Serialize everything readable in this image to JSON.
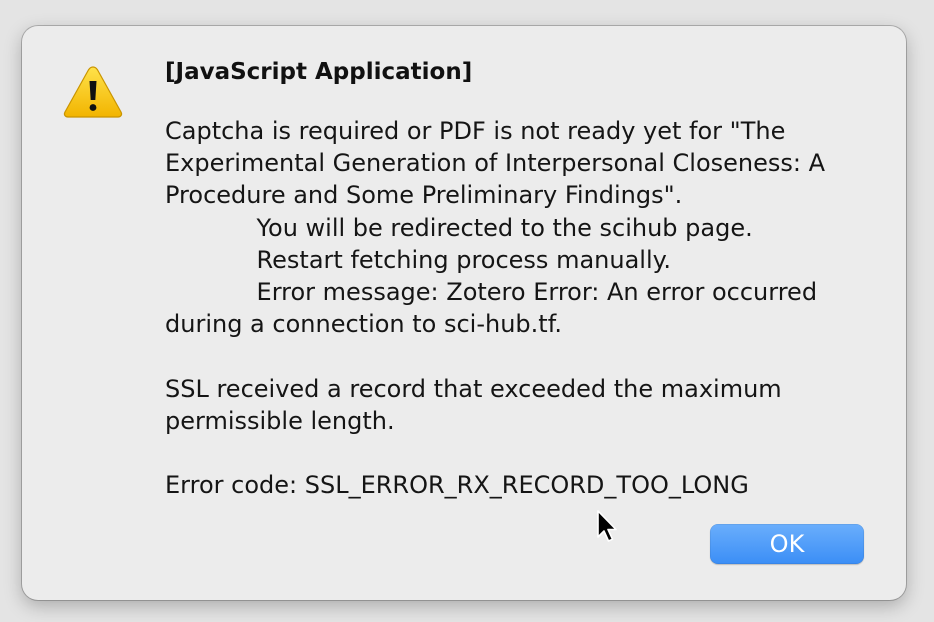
{
  "dialog": {
    "icon": "warning-icon",
    "title": "[JavaScript Application]",
    "message": "Captcha is required or PDF is not ready yet for \"The Experimental Generation of Interpersonal Closeness: A Procedure and Some Preliminary Findings\".\n\t    You will be redirected to the scihub page.\n\t    Restart fetching process manually.\n\t    Error message: Zotero Error: An error occurred during a connection to sci-hub.tf.\n\nSSL received a record that exceeded the maximum permissible length.\n\nError code: SSL_ERROR_RX_RECORD_TOO_LONG",
    "ok_label": "OK",
    "accent_color": "#3b8ef6"
  },
  "pointer": {
    "icon": "mouse-cursor-icon"
  }
}
